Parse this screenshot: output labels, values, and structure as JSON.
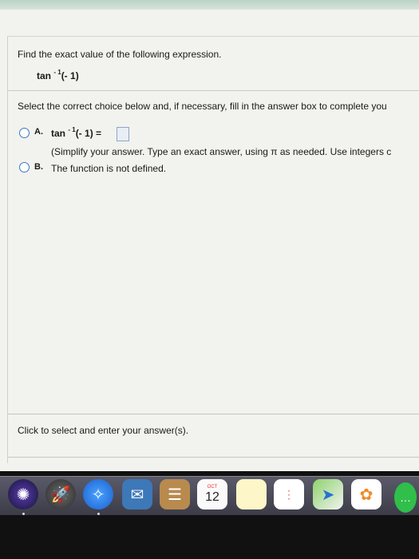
{
  "question": {
    "prompt": "Find the exact value of the following expression.",
    "expr_base": "tan",
    "expr_sup": "- 1",
    "expr_arg": "(- 1)",
    "instruction": "Select the correct choice below and, if necessary, fill in the answer box to complete you"
  },
  "choices": {
    "a": {
      "letter": "A.",
      "expr_base": "tan",
      "expr_sup": "- 1",
      "expr_arg": "(- 1) =",
      "hint": "(Simplify your answer. Type an exact answer, using π as needed. Use integers c"
    },
    "b": {
      "letter": "B.",
      "text": "The function is not defined."
    }
  },
  "footer": {
    "hint": "Click to select and enter your answer(s)."
  },
  "dock": {
    "calendar_month": "OCT",
    "calendar_day": "12",
    "icons": [
      "siri-icon",
      "launchpad-icon",
      "safari-icon",
      "mail-icon",
      "contacts-icon",
      "calendar-icon",
      "notes-icon",
      "reminders-icon",
      "maps-icon",
      "photos-icon",
      "messages-icon"
    ]
  }
}
